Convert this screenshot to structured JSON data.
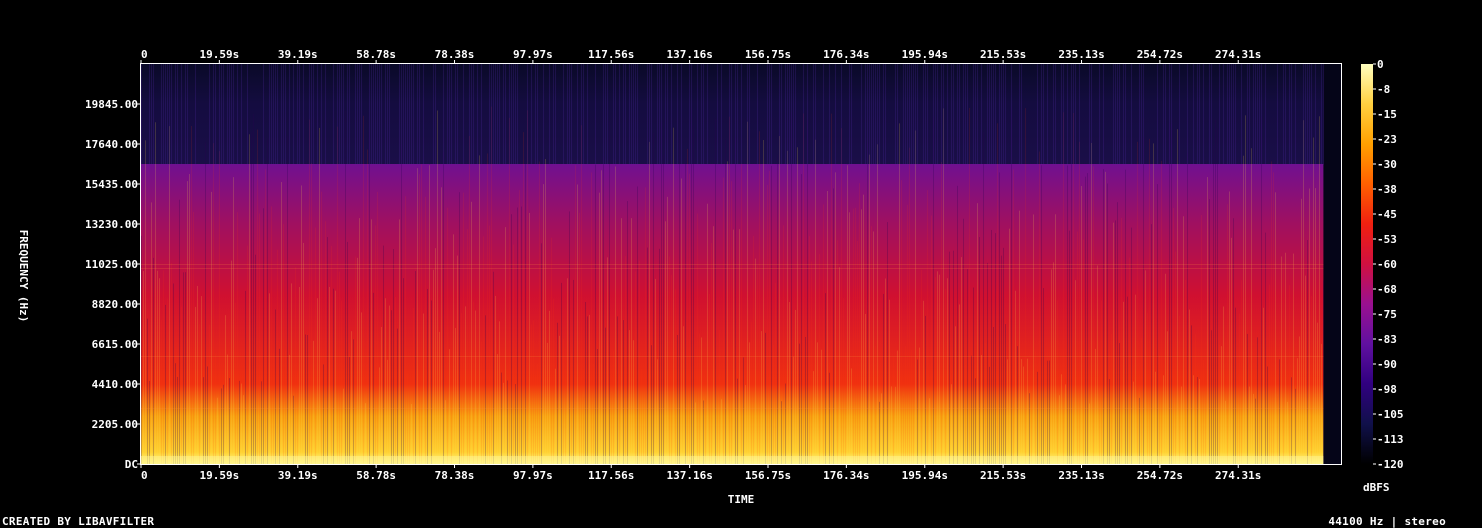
{
  "chart_data": {
    "type": "heatmap",
    "title": "",
    "xlabel": "TIME",
    "ylabel": "FREQUENCY (Hz)",
    "x_ticks": [
      "0",
      "19.59s",
      "39.19s",
      "58.78s",
      "78.38s",
      "97.97s",
      "117.56s",
      "137.16s",
      "156.75s",
      "176.34s",
      "195.94s",
      "215.53s",
      "235.13s",
      "254.72s",
      "274.31s"
    ],
    "x_tick_values": [
      0,
      19.59,
      39.19,
      58.78,
      78.38,
      97.97,
      117.56,
      137.16,
      156.75,
      176.34,
      195.94,
      215.53,
      235.13,
      254.72,
      274.31
    ],
    "x_range": [
      0,
      300
    ],
    "signal_end": 295.6,
    "y_ticks": [
      "DC",
      "2205.00",
      "4410.00",
      "6615.00",
      "8820.00",
      "11025.00",
      "13230.00",
      "15435.00",
      "17640.00",
      "19845.00"
    ],
    "y_tick_values": [
      0,
      2205,
      4410,
      6615,
      8820,
      11025,
      13230,
      15435,
      17640,
      19845
    ],
    "y_range": [
      0,
      22050
    ],
    "lowpass_cutoff_hz": 16500,
    "colorbar": {
      "label": "dBFS",
      "ticks": [
        "0",
        "-8",
        "-15",
        "-23",
        "-30",
        "-38",
        "-45",
        "-53",
        "-60",
        "-68",
        "-75",
        "-83",
        "-90",
        "-98",
        "-105",
        "-113",
        "-120"
      ],
      "range": [
        -120,
        0
      ],
      "colors": [
        "#000000",
        "#10104a",
        "#300080",
        "#6010a0",
        "#9a1090",
        "#d01040",
        "#f02010",
        "#ff6000",
        "#ffa000",
        "#ffd040",
        "#ffffc0"
      ]
    }
  },
  "footer": {
    "left": "CREATED BY LIBAVFILTER",
    "right": "44100 Hz | stereo"
  }
}
